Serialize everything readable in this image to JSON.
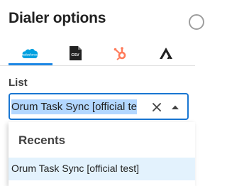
{
  "header": {
    "title": "Dialer options"
  },
  "tabs": [
    {
      "id": "salesforce",
      "icon": "salesforce-icon",
      "label": "salesforce",
      "active": true,
      "color": "#00a1e0"
    },
    {
      "id": "csv",
      "icon": "csv-file-icon",
      "label": "CSV",
      "active": false,
      "color": "#212121"
    },
    {
      "id": "hubspot",
      "icon": "hubspot-icon",
      "active": false,
      "color": "#ff7a59"
    },
    {
      "id": "apollo",
      "icon": "apollo-icon",
      "active": false,
      "color": "#212121"
    }
  ],
  "list": {
    "label": "List",
    "selected_value": "Orum Task Sync [official te",
    "clear_icon": "close-icon",
    "caret_icon": "caret-up-icon"
  },
  "dropdown": {
    "group_header": "Recents",
    "options": [
      {
        "label": "Orum Task Sync [official test]",
        "highlighted": true
      }
    ]
  },
  "colors": {
    "accent": "#1976d2",
    "selection": "#b3d7ff",
    "option_highlight": "#e3f2fd"
  }
}
